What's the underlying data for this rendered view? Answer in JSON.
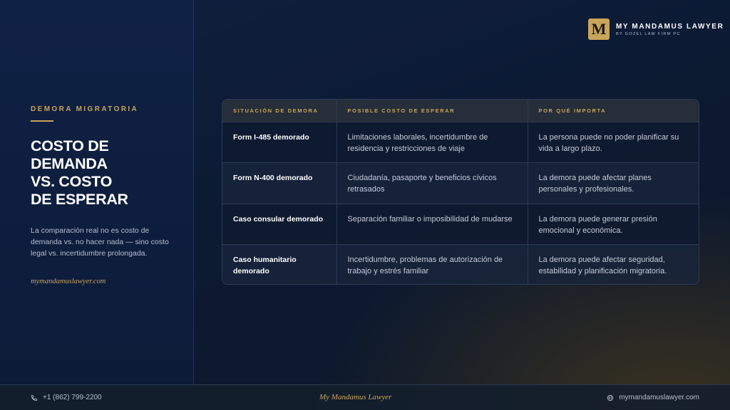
{
  "brand": {
    "mark": "M",
    "title": "MY MANDAMUS LAWYER",
    "subtitle": "BY GOZEL LAW FIRM PC"
  },
  "left": {
    "eyebrow": "DEMORA MIGRATORIA",
    "title_lines": [
      "COSTO DE",
      "DEMANDA",
      "VS. COSTO",
      "DE ESPERAR"
    ],
    "subtitle": "La comparación real no es costo de demanda vs. no hacer nada — sino costo legal vs. incertidumbre prolongada.",
    "site": "mymandamuslawyer.com"
  },
  "table": {
    "headers": [
      "SITUACIÓN DE DEMORA",
      "POSIBLE COSTO DE ESPERAR",
      "POR QUÉ IMPORTA"
    ],
    "rows": [
      [
        "Form I-485 demorado",
        "Limitaciones laborales, incertidumbre de residencia y restricciones de viaje",
        "La persona puede no poder planificar su vida a largo plazo."
      ],
      [
        "Form N-400 demorado",
        "Ciudadanía, pasaporte y beneficios cívicos retrasados",
        "La demora puede afectar planes personales y profesionales."
      ],
      [
        "Caso consular demorado",
        "Separación familiar o imposibilidad de mudarse",
        "La demora puede generar presión emocional y económica."
      ],
      [
        "Caso humanitario demorado",
        "Incertidumbre, problemas de autorización de trabajo y estrés familiar",
        "La demora puede afectar seguridad, estabilidad y planificación migratoria."
      ]
    ]
  },
  "footer": {
    "phone": "+1 (862) 799-2200",
    "center": "My Mandamus Lawyer",
    "site": "mymandamuslawyer.com",
    "phone_icon": "phone-icon",
    "site_icon": "globe-icon"
  },
  "colors": {
    "accent": "#c9a45b",
    "background": "#0c1a33"
  }
}
